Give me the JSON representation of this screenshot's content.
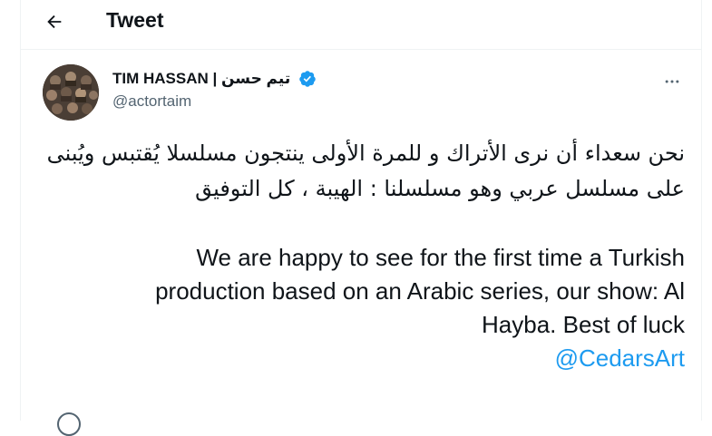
{
  "header": {
    "title": "Tweet"
  },
  "author": {
    "display_name": "TIM HASSAN | تيم حسن",
    "handle": "@actortaim",
    "verified": true
  },
  "tweet": {
    "arabic_text": "نحن سعداء أن نرى الأتراك و للمرة الأولى ينتجون مسلسلا يُقتبس ويُبنى على مسلسل عربي وهو مسلسلنا : الهيبة ، كل التوفيق",
    "english_text": "We are happy to see for the first time a Turkish production based on an Arabic series, our show: Al Hayba. Best of luck",
    "mention": "@CedarsArt"
  },
  "colors": {
    "link": "#1d9bf0",
    "verified": "#1d9bf0",
    "secondary_text": "#536471"
  },
  "icons": {
    "back": "arrow-left-icon",
    "verified": "verified-badge-icon",
    "more": "more-options-icon"
  }
}
